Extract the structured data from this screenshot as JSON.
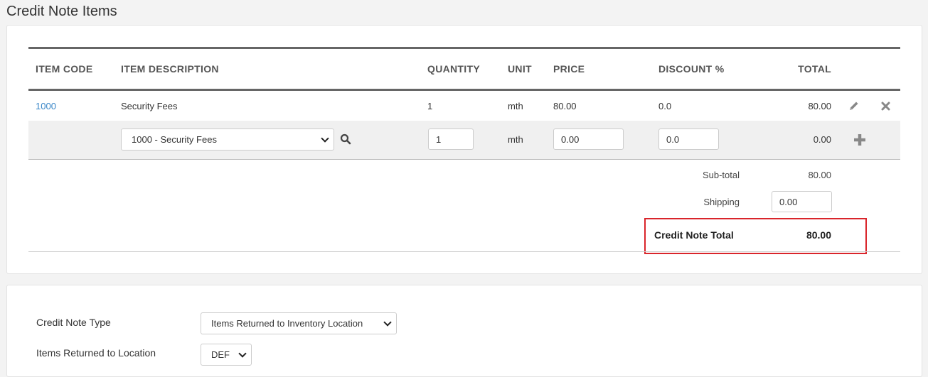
{
  "page": {
    "title": "Credit Note Items"
  },
  "table": {
    "headers": {
      "item_code": "ITEM CODE",
      "item_description": "ITEM DESCRIPTION",
      "quantity": "QUANTITY",
      "unit": "UNIT",
      "price": "PRICE",
      "discount": "DISCOUNT %",
      "total": "TOTAL"
    },
    "rows": [
      {
        "item_code": "1000",
        "description": "Security Fees",
        "quantity": "1",
        "unit": "mth",
        "price": "80.00",
        "discount": "0.0",
        "total": "80.00"
      }
    ],
    "new_row": {
      "item_select": "1000 - Security Fees",
      "quantity": "1",
      "unit": "mth",
      "price": "0.00",
      "discount": "0.0",
      "total": "0.00"
    }
  },
  "summary": {
    "subtotal_label": "Sub-total",
    "subtotal_value": "80.00",
    "shipping_label": "Shipping",
    "shipping_value": "0.00",
    "total_label": "Credit Note Total",
    "total_value": "80.00"
  },
  "form": {
    "credit_note_type_label": "Credit Note Type",
    "credit_note_type_value": "Items Returned to Inventory Location",
    "location_label": "Items Returned to Location",
    "location_value": "DEF"
  },
  "colors": {
    "link": "#3a87c8",
    "highlight_border": "#d9252b",
    "icon_gray": "#888888"
  }
}
